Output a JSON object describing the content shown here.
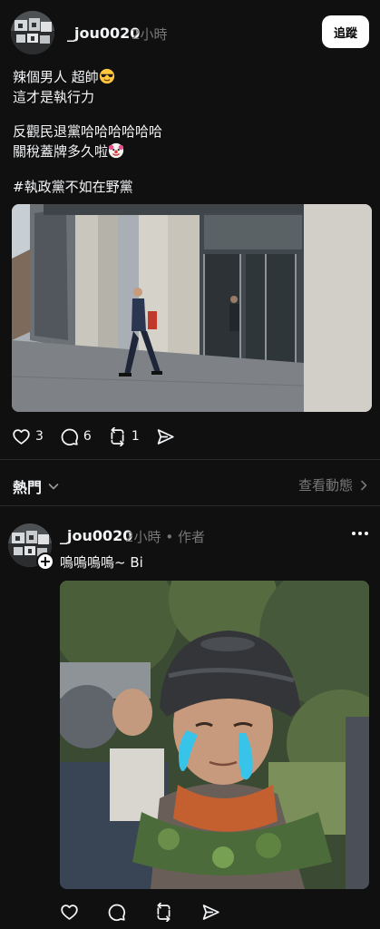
{
  "post1": {
    "username": "_jou0020",
    "time": "2小時",
    "follow_label": "追蹤",
    "lines": {
      "l1": "辣個男人 超帥",
      "l2": "這才是執行力",
      "l3": "反觀民退黨哈哈哈哈哈哈",
      "l4": "關稅蓋牌多久啦",
      "l5": "#執政黨不如在野黨"
    },
    "emoji_1": "sunglasses-emoji",
    "emoji_2": "clown-emoji",
    "likes": "3",
    "comments": "6",
    "reposts": "1"
  },
  "feed": {
    "hot_label": "熱門",
    "activity_label": "查看動態"
  },
  "post2": {
    "username": "_jou0020",
    "time": "2小時",
    "author_tag": "• 作者",
    "text": "嗚嗚嗚嗚~ Bi"
  },
  "icons": [
    "heart-icon",
    "comment-icon",
    "repost-icon",
    "share-icon",
    "chevron-down-icon",
    "chevron-right-icon",
    "plus-icon",
    "more-icon"
  ],
  "colors": {
    "background": "#101010",
    "text": "#f3f5f7",
    "secondary": "#777777",
    "divider": "#2b2b2b",
    "button": "#ffffff"
  }
}
